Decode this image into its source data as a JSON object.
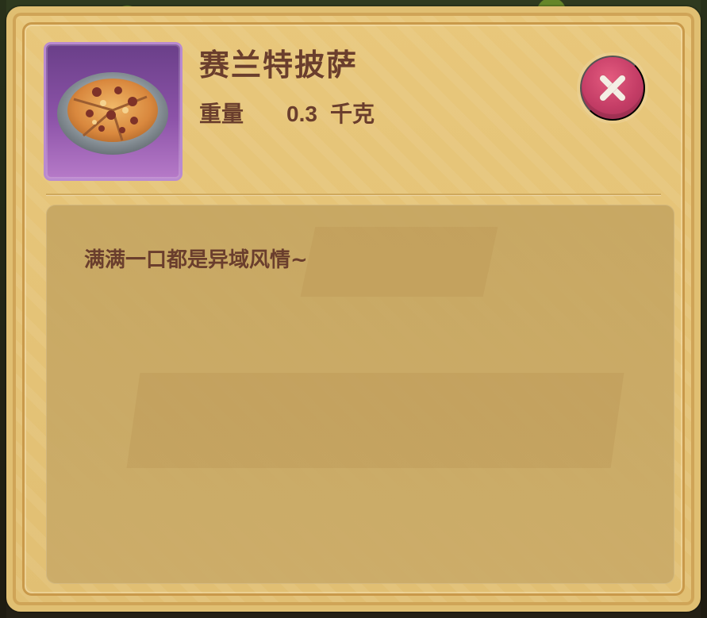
{
  "item": {
    "name": "赛兰特披萨",
    "weight_label": "重量",
    "weight_value": "0.3",
    "weight_unit": "千克",
    "description": "满满一口都是异域风情~",
    "icon": "pizza-icon"
  },
  "controls": {
    "close_icon": "close-icon"
  },
  "colors": {
    "panel": "#E1BF73",
    "text": "#6A3E2D",
    "item_card": "#8C53A8",
    "close_button": "#C43D66"
  }
}
